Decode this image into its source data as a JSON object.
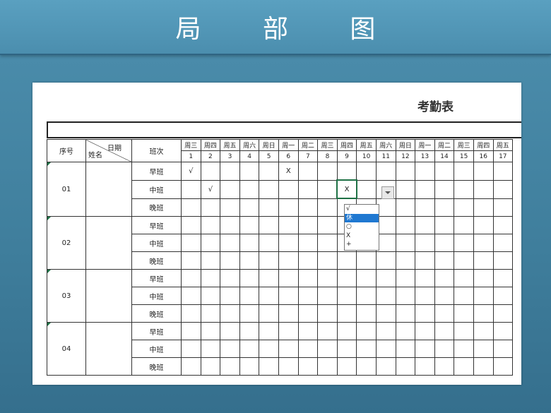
{
  "page": {
    "title": "局 部 图"
  },
  "sheet": {
    "title": "考勤表",
    "header": {
      "seq": "序号",
      "date": "日期",
      "name": "姓名",
      "shift": "班次"
    },
    "weekdays": [
      "周三",
      "周四",
      "周五",
      "周六",
      "周日",
      "周一",
      "周二",
      "周三",
      "周四",
      "周五",
      "周六",
      "周日",
      "周一",
      "周二",
      "周三",
      "周四",
      "周五"
    ],
    "days": [
      "1",
      "2",
      "3",
      "4",
      "5",
      "6",
      "7",
      "8",
      "9",
      "10",
      "11",
      "12",
      "13",
      "14",
      "15",
      "16",
      "17"
    ],
    "shifts": [
      "早班",
      "中班",
      "晚班"
    ],
    "employees": [
      {
        "seq": "01",
        "rows": [
          {
            "marks": [
              "√",
              "",
              "",
              "",
              "",
              "X",
              "",
              "",
              "",
              "",
              "",
              "",
              "",
              "",
              "",
              "",
              ""
            ]
          },
          {
            "marks": [
              "",
              "√",
              "",
              "",
              "",
              "",
              "",
              "",
              "X",
              "",
              "",
              "",
              "",
              "",
              "",
              "",
              ""
            ]
          },
          {
            "marks": [
              "",
              "",
              "",
              "",
              "",
              "",
              "",
              "",
              "",
              "",
              "",
              "",
              "",
              "",
              "",
              "",
              ""
            ]
          }
        ]
      },
      {
        "seq": "02",
        "rows": [
          {
            "marks": [
              "",
              "",
              "",
              "",
              "",
              "",
              "",
              "",
              "",
              "",
              "",
              "",
              "",
              "",
              "",
              "",
              ""
            ]
          },
          {
            "marks": [
              "",
              "",
              "",
              "",
              "",
              "",
              "",
              "",
              "",
              "",
              "",
              "",
              "",
              "",
              "",
              "",
              ""
            ]
          },
          {
            "marks": [
              "",
              "",
              "",
              "",
              "",
              "",
              "",
              "",
              "",
              "",
              "",
              "",
              "",
              "",
              "",
              "",
              ""
            ]
          }
        ]
      },
      {
        "seq": "03",
        "rows": [
          {
            "marks": [
              "",
              "",
              "",
              "",
              "",
              "",
              "",
              "",
              "",
              "",
              "",
              "",
              "",
              "",
              "",
              "",
              ""
            ]
          },
          {
            "marks": [
              "",
              "",
              "",
              "",
              "",
              "",
              "",
              "",
              "",
              "",
              "",
              "",
              "",
              "",
              "",
              "",
              ""
            ]
          },
          {
            "marks": [
              "",
              "",
              "",
              "",
              "",
              "",
              "",
              "",
              "",
              "",
              "",
              "",
              "",
              "",
              "",
              "",
              ""
            ]
          }
        ]
      },
      {
        "seq": "04",
        "rows": [
          {
            "marks": [
              "",
              "",
              "",
              "",
              "",
              "",
              "",
              "",
              "",
              "",
              "",
              "",
              "",
              "",
              "",
              "",
              ""
            ]
          },
          {
            "marks": [
              "",
              "",
              "",
              "",
              "",
              "",
              "",
              "",
              "",
              "",
              "",
              "",
              "",
              "",
              "",
              "",
              ""
            ]
          },
          {
            "marks": [
              "",
              "",
              "",
              "",
              "",
              "",
              "",
              "",
              "",
              "",
              "",
              "",
              "",
              "",
              "",
              "",
              ""
            ]
          }
        ]
      }
    ],
    "dropdown": {
      "options": [
        "√",
        "休",
        "○",
        "X",
        "+"
      ],
      "selected_index": 1
    }
  },
  "colors": {
    "background": "#3f7e9c",
    "active_cell_border": "#1e7145",
    "selection": "#1f78d1"
  }
}
